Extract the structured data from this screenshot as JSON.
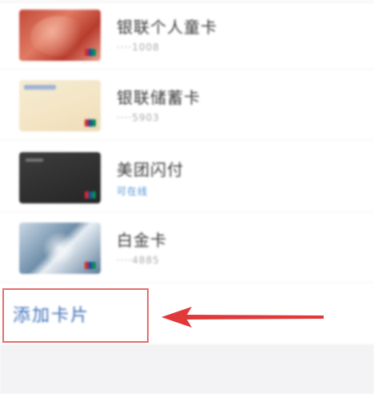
{
  "cards": [
    {
      "title": "银联个人童卡",
      "subtitle": "····1008",
      "thumb_style": "red"
    },
    {
      "title": "银联储蓄卡",
      "subtitle": "····5903",
      "thumb_style": "cream"
    },
    {
      "title": "美团闪付",
      "subtitle": "可在线",
      "thumb_style": "black"
    },
    {
      "title": "白金卡",
      "subtitle": "····4885",
      "thumb_style": "silver"
    }
  ],
  "add_card": {
    "label": "添加卡片"
  },
  "colors": {
    "link": "#3f71b8",
    "highlight_box": "#e46e6e",
    "arrow": "#e0393a",
    "section_bg": "#f3f3f5"
  }
}
